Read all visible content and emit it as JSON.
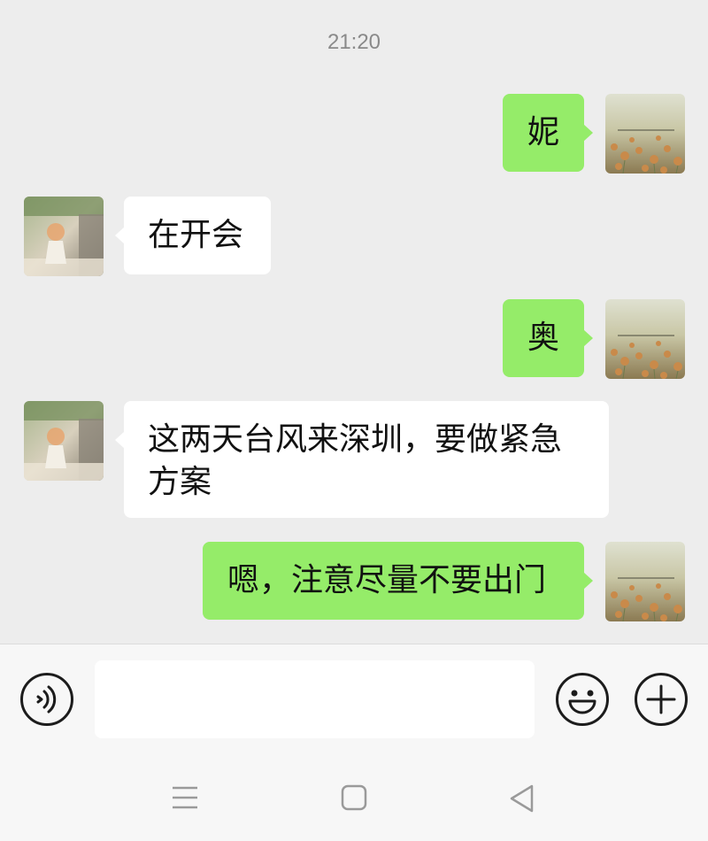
{
  "chat": {
    "timestamp": "21:20",
    "messages": [
      {
        "direction": "out",
        "text": "妮"
      },
      {
        "direction": "in",
        "text": "在开会"
      },
      {
        "direction": "out",
        "text": "奥"
      },
      {
        "direction": "in",
        "text_line1": "这两天台风来深圳，要做紧急",
        "text_line2": "方案"
      },
      {
        "direction": "out",
        "text": "嗯，注意尽量不要出门"
      }
    ]
  },
  "input_bar": {
    "voice_icon": "voice-icon",
    "emoji_icon": "emoji-icon",
    "add_icon": "plus-icon",
    "placeholder": ""
  },
  "nav": {
    "menu_icon": "menu-icon",
    "home_icon": "home-square-icon",
    "back_icon": "back-triangle-icon"
  },
  "colors": {
    "background": "#ededed",
    "outgoing_bubble": "#95ec69",
    "incoming_bubble": "#ffffff"
  }
}
